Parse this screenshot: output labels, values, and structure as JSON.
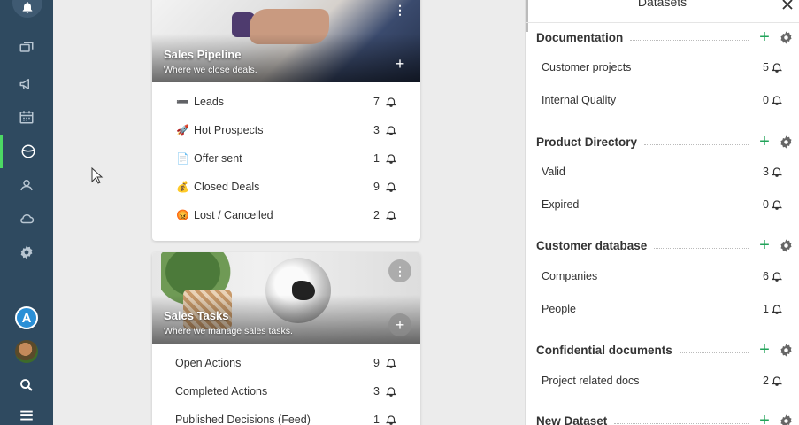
{
  "panel": {
    "title": "Datasets",
    "datasets": [
      {
        "name": "Documentation",
        "items": [
          {
            "label": "Customer projects",
            "count": "5"
          },
          {
            "label": "Internal Quality",
            "count": "0"
          }
        ]
      },
      {
        "name": "Product Directory",
        "items": [
          {
            "label": "Valid",
            "count": "3"
          },
          {
            "label": "Expired",
            "count": "0"
          }
        ]
      },
      {
        "name": "Customer database",
        "items": [
          {
            "label": "Companies",
            "count": "6"
          },
          {
            "label": "People",
            "count": "1"
          }
        ]
      },
      {
        "name": "Confidential documents",
        "items": [
          {
            "label": "Project related docs",
            "count": "2"
          }
        ]
      },
      {
        "name": "New Dataset",
        "items": []
      }
    ]
  },
  "cards": [
    {
      "title": "Sales Pipeline",
      "subtitle": "Where we close deals.",
      "rows": [
        {
          "emoji": "➖",
          "label": "Leads",
          "count": "7"
        },
        {
          "emoji": "🚀",
          "label": "Hot Prospects",
          "count": "3"
        },
        {
          "emoji": "📄",
          "label": "Offer sent",
          "count": "1"
        },
        {
          "emoji": "💰",
          "label": "Closed Deals",
          "count": "9"
        },
        {
          "emoji": "😡",
          "label": "Lost / Cancelled",
          "count": "2"
        }
      ]
    },
    {
      "title": "Sales Tasks",
      "subtitle": "Where we manage sales tasks.",
      "rows": [
        {
          "emoji": "",
          "label": "Open Actions",
          "count": "9"
        },
        {
          "emoji": "",
          "label": "Completed Actions",
          "count": "3"
        },
        {
          "emoji": "",
          "label": "Published Decisions (Feed)",
          "count": "1"
        }
      ]
    }
  ],
  "nav": {
    "avatar_letter": "A",
    "icons": [
      "bell-icon",
      "chat-icon",
      "megaphone-icon",
      "calendar-icon",
      "globe-icon",
      "users-icon",
      "cloud-icon",
      "gear-icon",
      "search-icon",
      "menu-icon"
    ]
  },
  "colors": {
    "nav_bg": "#2f4a60",
    "accent_green": "#22a35a",
    "active_marker": "#4cd964",
    "avatar_blue": "#2a8fd6"
  }
}
